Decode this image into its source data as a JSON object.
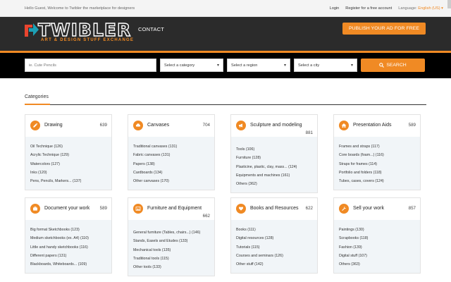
{
  "topbar": {
    "welcome": "Hello Guest, Welcome to Twibler the marketplace for designers",
    "login": "Login",
    "register": "Register for a free account",
    "language_label": "Language:",
    "language_value": "English (US) ▾"
  },
  "header": {
    "logo_text": "TWIBLER",
    "logo_tagline": "ART & DESIGN STUFF EXCHANGE",
    "nav_contact": "CONTACT",
    "publish_label": "PUBLISH YOUR AD FOR FREE"
  },
  "search": {
    "keyword_placeholder": "ie. Cute Pencils",
    "category": "Select a category",
    "region": "Select a region",
    "city": "Select a city",
    "button": "SEARCH"
  },
  "categories_title": "Categories",
  "colors": {
    "accent": "#f08a24",
    "header_bg": "#2b2b2b",
    "search_bg": "#000000",
    "card_body": "#f1f5f8"
  },
  "cards": [
    {
      "icon": "pencil-icon",
      "name": "Drawing",
      "count": "639",
      "items": [
        "Oil Technique (126)",
        "Acrylic Technique (129)",
        "Watercolors (127)",
        "Inks (120)",
        "Pens, Pencils, Markers... (137)"
      ]
    },
    {
      "icon": "car-icon",
      "name": "Canvases",
      "count": "704",
      "items": [
        "Traditional canvases (131)",
        "Fabric canvases (131)",
        "Papers (138)",
        "Cardboards (134)",
        "Other canvases (170)"
      ]
    },
    {
      "icon": "megaphone-icon",
      "name": "Sculpture and modeling",
      "count": "881",
      "items": [
        "Tools (106)",
        "Furniture (128)",
        "Plasticine, plastic, clay, mass... (124)",
        "Equipments and machines (161)",
        "Others (362)"
      ]
    },
    {
      "icon": "home-icon",
      "name": "Presentation Aids",
      "count": "589",
      "items": [
        "Frames and straps (117)",
        "Core boards (foam...) (116)",
        "Straps for frames (114)",
        "Portfolio and folders (118)",
        "Tubes, cases, covers (124)"
      ]
    },
    {
      "icon": "briefcase-icon",
      "name": "Document your work",
      "count": "589",
      "items": [
        "Big format Sketchbooks (123)",
        "Medium sketchbooks (ex. A4) (110)",
        "Little and handy sketchbooks (116)",
        "Different papers (131)",
        "Blackboards, Whiteboards... (109)"
      ]
    },
    {
      "icon": "image-icon",
      "name": "Furniture and Equipment",
      "count": "662",
      "items": [
        "General furniture (Tables, chairs...) (146)",
        "Stands, Easels and Etudes (133)",
        "Mechanical tools (135)",
        "Traditional tools (115)",
        "Other tools (133)"
      ]
    },
    {
      "icon": "heart-icon",
      "name": "Books and Resources",
      "count": "622",
      "items": [
        "Books (111)",
        "Digital resources (128)",
        "Tutorials (115)",
        "Courses and seminars (126)",
        "Other stuff (142)"
      ]
    },
    {
      "icon": "wrench-icon",
      "name": "Sell your work",
      "count": "857",
      "items": [
        "Paintings (130)",
        "Scrapbooks (118)",
        "Fashion (139)",
        "Digital stuff (107)",
        "Others (363)"
      ]
    }
  ]
}
